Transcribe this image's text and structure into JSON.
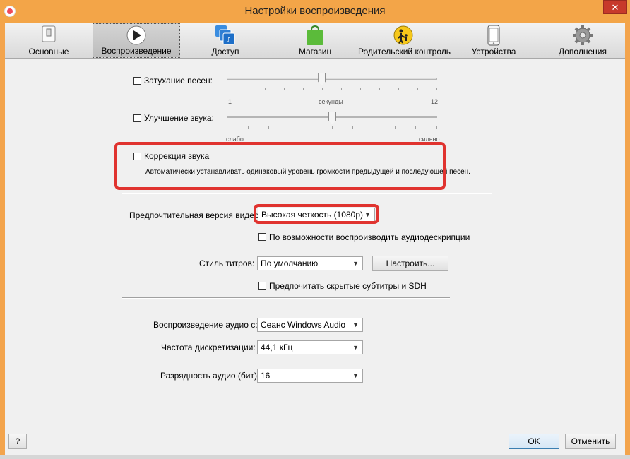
{
  "window": {
    "title": "Настройки воспроизведения",
    "close_glyph": "✕"
  },
  "tabs": [
    {
      "label": "Основные",
      "icon": "switch-icon"
    },
    {
      "label": "Воспроизведение",
      "icon": "play-icon",
      "active": true
    },
    {
      "label": "Доступ",
      "icon": "sharing-icon"
    },
    {
      "label": "Магазин",
      "icon": "store-bag-icon"
    },
    {
      "label": "Родительский контроль",
      "icon": "parental-icon"
    },
    {
      "label": "Устройства",
      "icon": "phone-icon"
    },
    {
      "label": "Дополнения",
      "icon": "gear-icon"
    }
  ],
  "crossfade": {
    "label": "Затухание песен:",
    "checked": false,
    "min": "1",
    "unit": "секунды",
    "max": "12",
    "value_fraction": 0.45
  },
  "enhancer": {
    "label": "Улучшение звука:",
    "checked": false,
    "min": "слабо",
    "max": "сильно",
    "value_fraction": 0.5
  },
  "sound_check": {
    "label": "Коррекция звука",
    "checked": false,
    "description": "Автоматически устанавливать одинаковый уровень громкости предыдущей и последующей песен."
  },
  "video": {
    "label": "Предпочтительная версия видео:",
    "value": "Высокая четкость (1080p)"
  },
  "audio_desc": {
    "label": "По возможности воспроизводить аудиодескрипции",
    "checked": false
  },
  "subtitles": {
    "label": "Стиль титров:",
    "value": "По умолчанию",
    "configure_button": "Настроить..."
  },
  "sdh": {
    "label": "Предпочитать скрытые субтитры и SDH",
    "checked": false
  },
  "audio_output": {
    "label": "Воспроизведение аудио с:",
    "value": "Сеанс Windows Audio"
  },
  "sample_rate": {
    "label": "Частота дискретизации:",
    "value": "44,1 кГц"
  },
  "bit_depth": {
    "label": "Разрядность аудио (бит):",
    "value": "16"
  },
  "footer": {
    "help": "?",
    "ok": "OK",
    "cancel": "Отменить"
  },
  "colors": {
    "highlight": "#e0332f",
    "title_bar": "#f3a548"
  }
}
